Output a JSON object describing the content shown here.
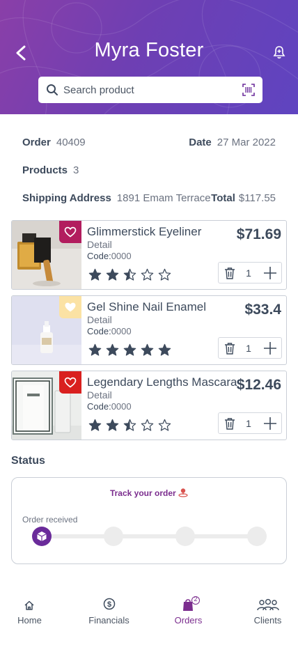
{
  "header": {
    "title": "Myra Foster",
    "search_placeholder": "Search product"
  },
  "order": {
    "order_label": "Order",
    "order_value": "40409",
    "date_label": "Date",
    "date_value": "27 Mar 2022",
    "products_label": "Products",
    "products_value": "3",
    "shipping_label": "Shipping Address",
    "shipping_value": "1891 Emam Terrace",
    "total_label": "Total",
    "total_value": "$117.55"
  },
  "products": [
    {
      "name": "Glimmerstick Eyeliner",
      "detail": "Detail",
      "code_label": "Code:",
      "code_value": "0000",
      "price": "$71.69",
      "rating": 2.5,
      "qty": "1",
      "favorite_color": "#b21d5e",
      "favorite_icon": "heart-outline-icon"
    },
    {
      "name": "Gel Shine Nail Enamel",
      "detail": "Detail",
      "code_label": "Code:",
      "code_value": "0000",
      "price": "$33.4",
      "rating": 5,
      "qty": "1",
      "favorite_color": "#fbe2a4",
      "favorite_icon": "heart-filled-icon"
    },
    {
      "name": "Legendary Lengths Mascara",
      "detail": "Detail",
      "code_label": "Code:",
      "code_value": "0000",
      "price": "$12.46",
      "rating": 2.5,
      "qty": "1",
      "favorite_color": "#d9201f",
      "favorite_icon": "heart-outline-icon"
    }
  ],
  "status": {
    "heading": "Status",
    "track_label": "Track your order",
    "step_label": "Order received"
  },
  "tabs": [
    {
      "label": "Home",
      "icon": "home-icon"
    },
    {
      "label": "Financials",
      "icon": "dollar-circle-icon"
    },
    {
      "label": "Orders",
      "icon": "shopping-bag-icon",
      "badge": "2",
      "active": true
    },
    {
      "label": "Clients",
      "icon": "users-icon"
    }
  ],
  "colors": {
    "header_gradient_start": "#8a3fa8",
    "header_gradient_end": "#5f44c0",
    "accent": "#7b2d8e",
    "text": "#3d4a5c",
    "star": "#3d4a5c"
  }
}
